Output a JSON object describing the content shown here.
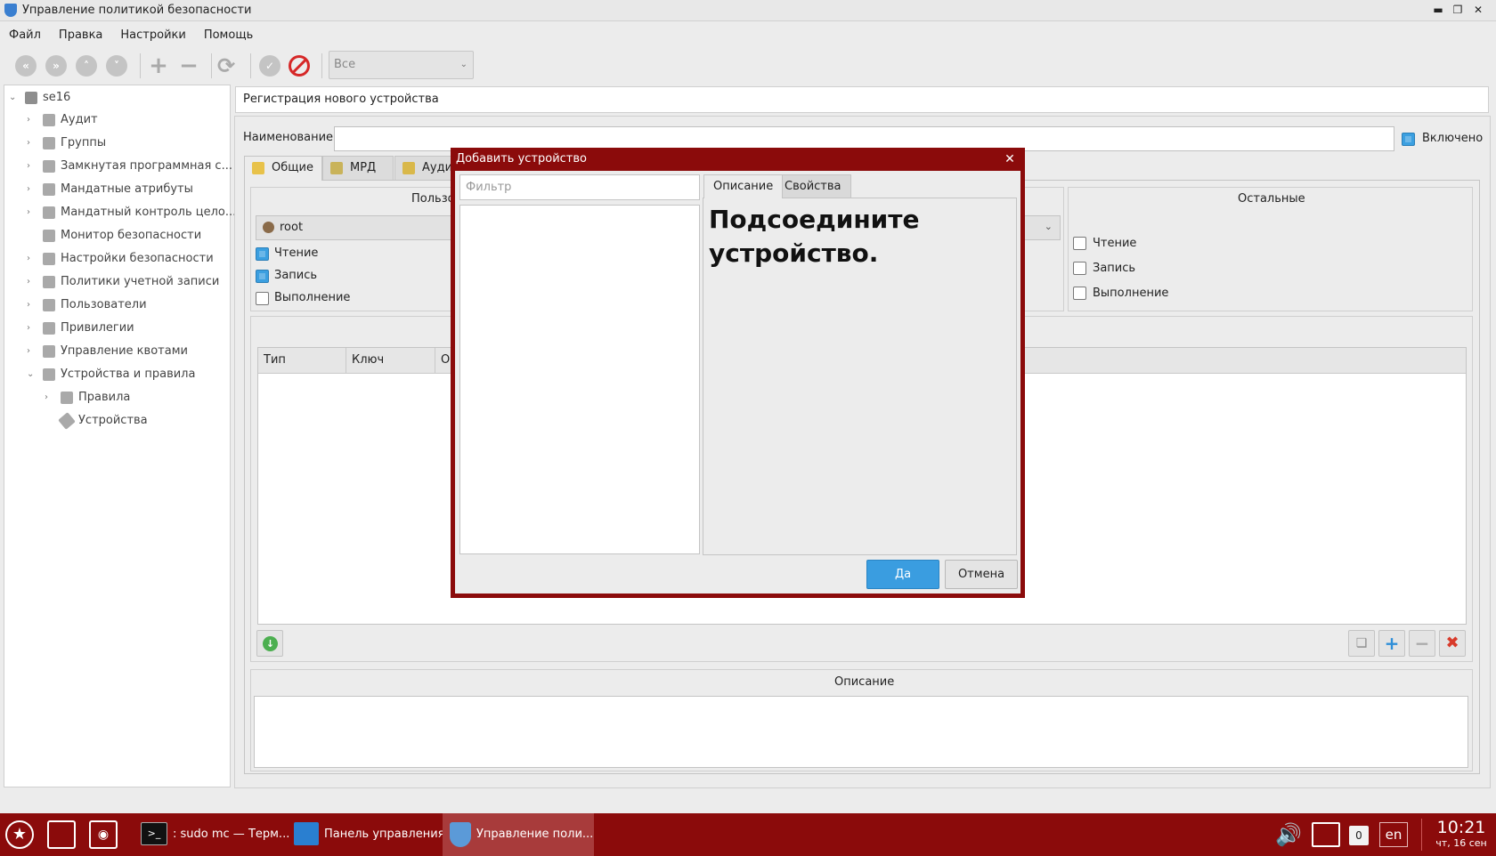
{
  "window": {
    "title": "Управление политикой безопасности"
  },
  "menu": [
    "Файл",
    "Правка",
    "Настройки",
    "Помощь"
  ],
  "toolbar": {
    "filter_value": "Все"
  },
  "tree": {
    "root": "se16",
    "items": [
      {
        "label": "Аудит"
      },
      {
        "label": "Группы"
      },
      {
        "label": "Замкнутая программная с..."
      },
      {
        "label": "Мандатные атрибуты"
      },
      {
        "label": "Мандатный контроль цело..."
      },
      {
        "label": "Монитор безопасности"
      },
      {
        "label": "Настройки безопасности"
      },
      {
        "label": "Политики учетной записи"
      },
      {
        "label": "Пользователи"
      },
      {
        "label": "Привилегии"
      },
      {
        "label": "Управление квотами"
      },
      {
        "label": "Устройства и правила"
      }
    ],
    "children": [
      {
        "label": "Правила"
      },
      {
        "label": "Устройства"
      }
    ]
  },
  "main": {
    "path": "Регистрация нового устройства",
    "name_label": "Наименование:",
    "name_value": "",
    "enabled_label": "Включено",
    "tabs": [
      "Общие",
      "МРД",
      "Аудит"
    ],
    "user_group_title": "Пользо",
    "user_value": "root",
    "user_perms": [
      {
        "label": "Чтение",
        "checked": true
      },
      {
        "label": "Запись",
        "checked": true
      },
      {
        "label": "Выполнение",
        "checked": false
      }
    ],
    "other_group_title": "Остальные",
    "other_perms": [
      {
        "label": "Чтение",
        "checked": false
      },
      {
        "label": "Запись",
        "checked": false
      },
      {
        "label": "Выполнение",
        "checked": false
      }
    ],
    "table_columns": [
      "Тип",
      "Ключ",
      "О"
    ],
    "desc_title": "Описание"
  },
  "dialog": {
    "title": "Добавить устройство",
    "filter_placeholder": "Фильтр",
    "tabs": [
      "Описание",
      "Свойства"
    ],
    "message": "Подсоедините устройство.",
    "ok": "Да",
    "cancel": "Отмена"
  },
  "taskbar": {
    "tasks": [
      {
        "label": ": sudo mc — Терм..."
      },
      {
        "label": "Панель управления"
      },
      {
        "label": "Управление поли..."
      }
    ],
    "tray_badge": "0",
    "lang": "en",
    "time": "10:21",
    "date": "чт, 16 сен"
  },
  "colors": {
    "accent": "#3b9fe0",
    "taskbar": "#8b0b0b",
    "dialog_frame": "#8b0b0b"
  }
}
